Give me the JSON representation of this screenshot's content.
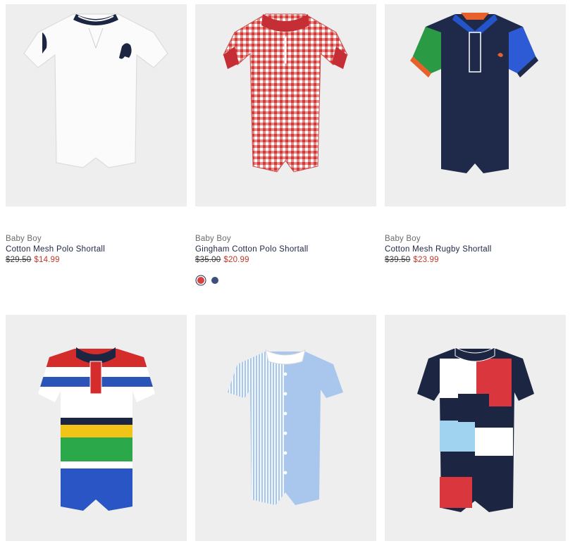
{
  "products": [
    {
      "category": "Baby Boy",
      "name": "Cotton Mesh Polo Shortall",
      "old_price": "$29.50",
      "sale_price": "$14.99",
      "swatches": []
    },
    {
      "category": "Baby Boy",
      "name": "Gingham Cotton Polo Shortall",
      "old_price": "$35.00",
      "sale_price": "$20.99",
      "swatches": [
        "#d8413f",
        "#3d4f7a"
      ]
    },
    {
      "category": "Baby Boy",
      "name": "Cotton Mesh Rugby Shortall",
      "old_price": "$39.50",
      "sale_price": "$23.99",
      "swatches": []
    },
    {
      "swatches": []
    },
    {
      "swatches": []
    },
    {
      "swatches": []
    }
  ],
  "colors": {
    "sale": "#c0392b",
    "tile_bg": "#efeeee",
    "navy": "#1c2541"
  }
}
